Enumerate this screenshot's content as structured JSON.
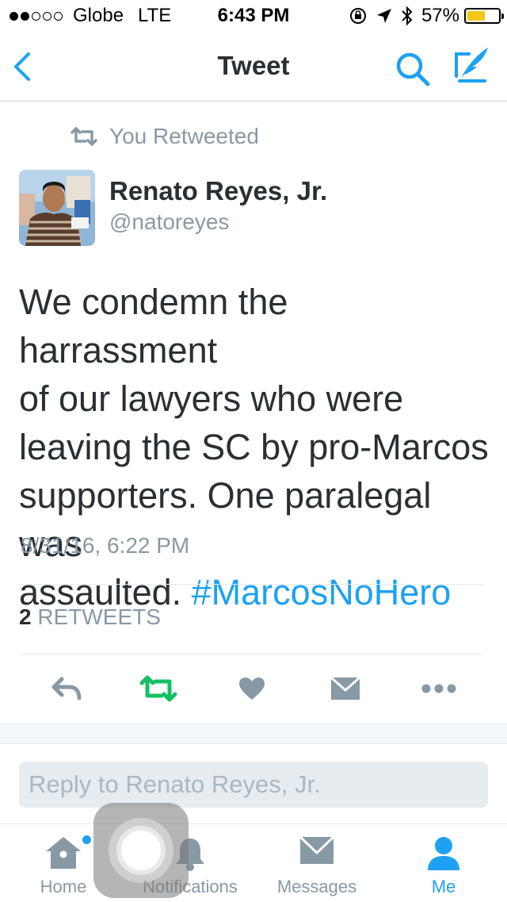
{
  "status_bar": {
    "carrier": "Globe",
    "network": "LTE",
    "time": "6:43 PM",
    "battery": "57%",
    "battery_level": 0.57,
    "signal_bars": 2,
    "signal_total": 5
  },
  "nav": {
    "title": "Tweet"
  },
  "tweet": {
    "retweet_notice": "You Retweeted",
    "author_name": "Renato Reyes, Jr.",
    "author_handle": "@natoreyes",
    "text_lines": [
      "We condemn the harrassment",
      "of our lawyers who were",
      "leaving the SC by pro-Marcos",
      "supporters. One paralegal was",
      "assaulted. "
    ],
    "hashtag": "#MarcosNoHero",
    "timestamp": "8/31/16, 6:22 PM",
    "retweet_count": "2",
    "retweet_label": "RETWEETS"
  },
  "reply": {
    "placeholder": "Reply to Renato Reyes, Jr."
  },
  "tabs": [
    {
      "label": "Home",
      "icon": "home-icon"
    },
    {
      "label": "Notifications",
      "icon": "bell-icon"
    },
    {
      "label": "Messages",
      "icon": "envelope-icon"
    },
    {
      "label": "Me",
      "icon": "person-icon"
    }
  ],
  "colors": {
    "accent": "#1da1f2",
    "retweet_active": "#17bf63",
    "muted": "#8899a6",
    "text": "#292f33"
  }
}
